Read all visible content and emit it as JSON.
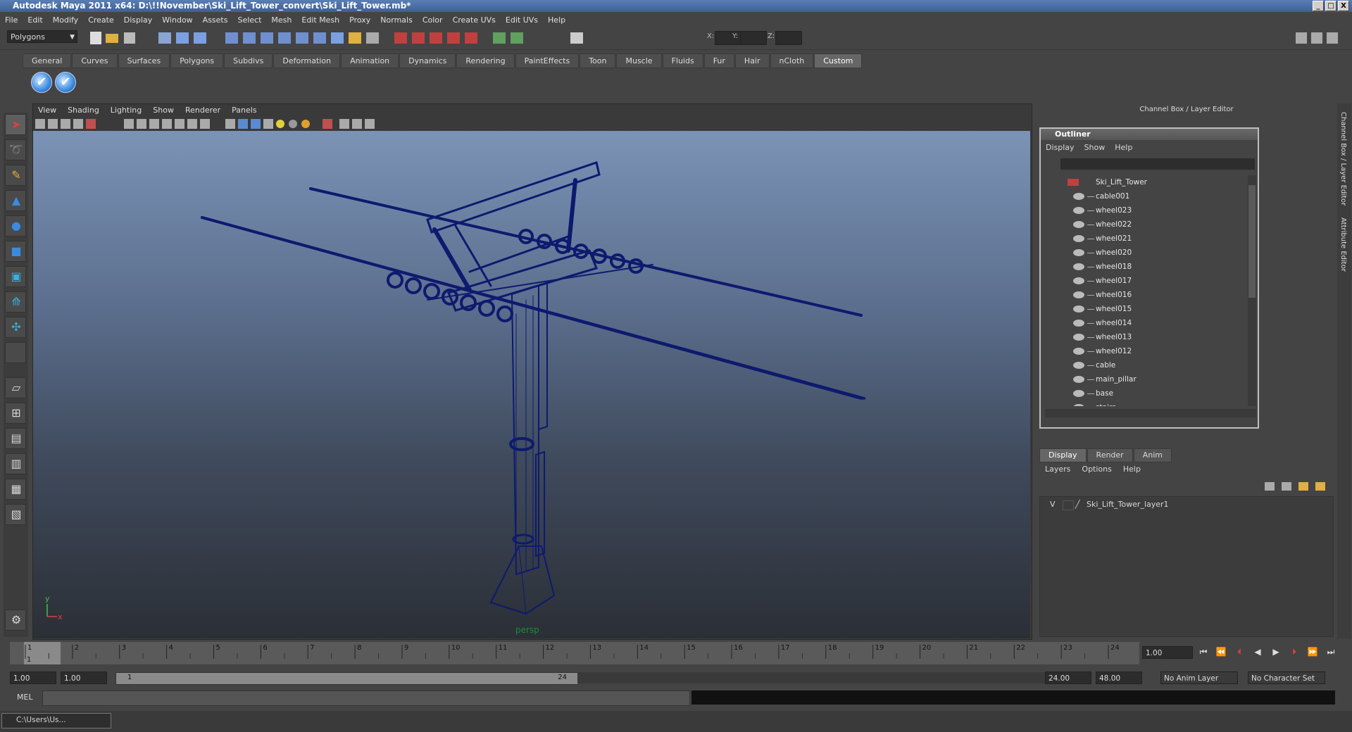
{
  "window": {
    "title": "Autodesk Maya 2011 x64: D:\\!!November\\Ski_Lift_Tower_convert\\Ski_Lift_Tower.mb*",
    "controls": [
      "_",
      "□",
      "X"
    ]
  },
  "menubar": [
    "File",
    "Edit",
    "Modify",
    "Create",
    "Display",
    "Window",
    "Assets",
    "Select",
    "Mesh",
    "Edit Mesh",
    "Proxy",
    "Normals",
    "Color",
    "Create UVs",
    "Edit UVs",
    "Help"
  ],
  "status_line": {
    "mode": "Polygons",
    "coord_labels": [
      "X:",
      "Y:",
      "Z:"
    ]
  },
  "shelf": {
    "tabs": [
      "General",
      "Curves",
      "Surfaces",
      "Polygons",
      "Subdivs",
      "Deformation",
      "Animation",
      "Dynamics",
      "Rendering",
      "PaintEffects",
      "Toon",
      "Muscle",
      "Fluids",
      "Fur",
      "Hair",
      "nCloth",
      "Custom"
    ],
    "active_tab": "Custom",
    "buttons": [
      "✔",
      "✔"
    ]
  },
  "viewport": {
    "menu": [
      "View",
      "Shading",
      "Lighting",
      "Show",
      "Renderer",
      "Panels"
    ],
    "camera_label": "persp",
    "axis_y": "y",
    "axis_x": "x",
    "wire_color": "#0d1a6e"
  },
  "channel_box": {
    "title": "Channel Box / Layer Editor",
    "side_tabs": [
      "Channel Box / Layer Editor",
      "Attribute Editor"
    ]
  },
  "outliner": {
    "title": "Outliner",
    "menu": [
      "Display",
      "Show",
      "Help"
    ],
    "root": "Ski_Lift_Tower",
    "items": [
      "cable001",
      "wheel023",
      "wheel022",
      "wheel021",
      "wheel020",
      "wheel018",
      "wheel017",
      "wheel016",
      "wheel015",
      "wheel014",
      "wheel013",
      "wheel012",
      "cable",
      "main_pillar",
      "base",
      "stairs"
    ]
  },
  "layer_editor": {
    "tabs": [
      "Display",
      "Render",
      "Anim"
    ],
    "active_tab": "Display",
    "menu": [
      "Layers",
      "Options",
      "Help"
    ],
    "layers": [
      {
        "visible": "V",
        "name": "Ski_Lift_Tower_layer1"
      }
    ]
  },
  "timeline": {
    "ticks": [
      "1",
      "2",
      "3",
      "4",
      "5",
      "6",
      "7",
      "8",
      "9",
      "10",
      "11",
      "12",
      "13",
      "14",
      "15",
      "16",
      "17",
      "18",
      "19",
      "20",
      "21",
      "22",
      "23",
      "24"
    ],
    "current_frame_label": "1",
    "current_time": "1.00"
  },
  "range": {
    "start": "1.00",
    "playback_start": "1.00",
    "slider_start": "1",
    "slider_end": "24",
    "playback_end": "24.00",
    "end": "48.00",
    "anim_layer": "No Anim Layer",
    "character_set": "No Character Set"
  },
  "command_line": {
    "label": "MEL"
  },
  "taskbar": {
    "item": "C:\\Users\\Us..."
  }
}
